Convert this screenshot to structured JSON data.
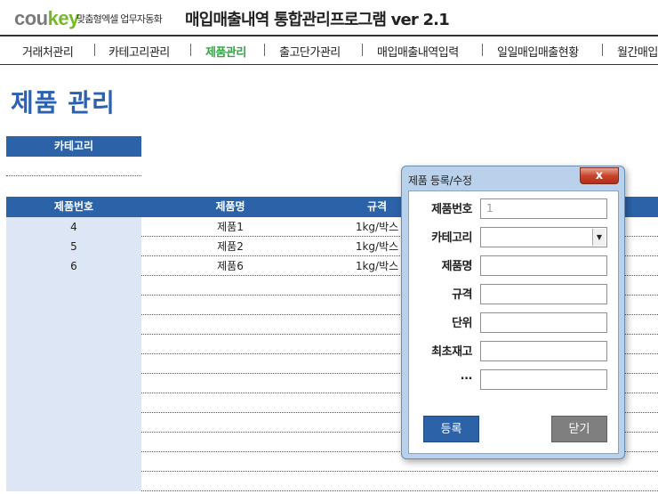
{
  "header": {
    "logo_co": "cou",
    "logo_key": "key",
    "tagline": "맞춤형엑셀 업무자동화",
    "app_title": "매입매출내역 통합관리프로그램 ver 2.1"
  },
  "nav": {
    "items": [
      {
        "label": "거래처관리",
        "active": false
      },
      {
        "label": "카테고리관리",
        "active": false
      },
      {
        "label": "제품관리",
        "active": true
      },
      {
        "label": "출고단가관리",
        "active": false
      },
      {
        "label": "매입매출내역입력",
        "active": false
      },
      {
        "label": "일일매입매출현황",
        "active": false
      },
      {
        "label": "월간매입",
        "active": false
      }
    ]
  },
  "page": {
    "title": "제품 관리",
    "category_header": "카테고리"
  },
  "table": {
    "columns": [
      "제품번호",
      "제품명",
      "규격"
    ],
    "rows": [
      {
        "no": "4",
        "name": "제품1",
        "spec": "1kg/박스"
      },
      {
        "no": "5",
        "name": "제품2",
        "spec": "1kg/박스"
      },
      {
        "no": "6",
        "name": "제품6",
        "spec": "1kg/박스"
      }
    ]
  },
  "dialog": {
    "title": "제품 등록/수정",
    "close_symbol": "x",
    "fields": {
      "product_no_label": "제품번호",
      "product_no_value": "1",
      "category_label": "카테고리",
      "name_label": "제품명",
      "spec_label": "규격",
      "unit_label": "단위",
      "initial_stock_label": "최초재고",
      "etc_label": "..."
    },
    "register_label": "등록",
    "close_label": "닫기"
  },
  "colors": {
    "accent_blue": "#2c63a8",
    "active_nav_green": "#3aa14a",
    "logo_green": "#77b82a",
    "dialog_frame": "#b9d1ea"
  }
}
